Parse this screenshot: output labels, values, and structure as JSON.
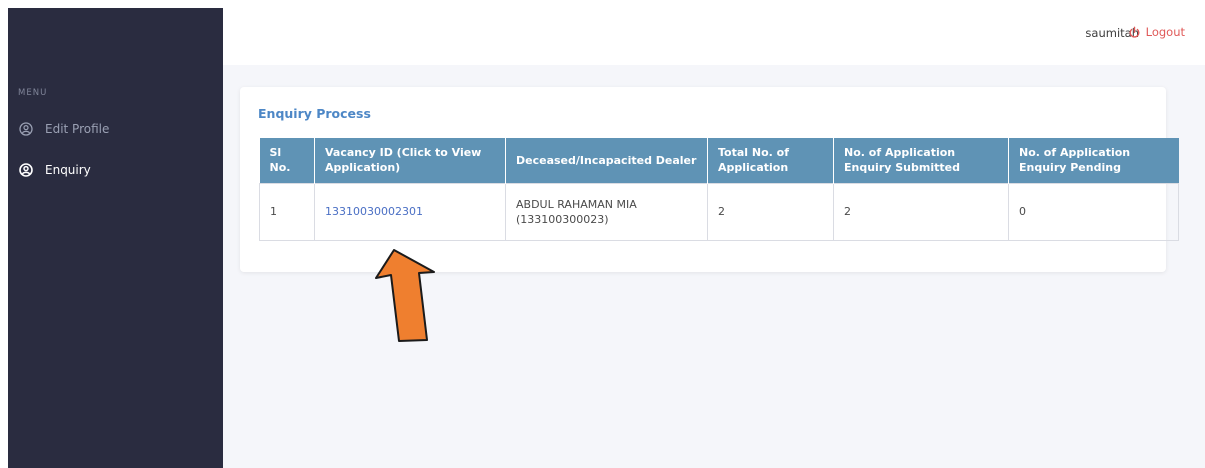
{
  "sidebar": {
    "menu_title": "MENU",
    "items": [
      {
        "label": "Edit Profile",
        "icon": "user-circle-icon"
      },
      {
        "label": "Enquiry",
        "icon": "user-circle-icon",
        "active": true
      }
    ]
  },
  "topbar": {
    "username": "saumitah",
    "logout_label": "Logout",
    "logout_icon": "power-icon"
  },
  "card": {
    "title": "Enquiry Process"
  },
  "table": {
    "headers": [
      "Sl No.",
      "Vacancy ID (Click to View Application)",
      "Deceased/Incapacited Dealer",
      "Total No. of Application",
      "No. of Application Enquiry Submitted",
      "No. of Application Enquiry Pending"
    ],
    "rows": [
      {
        "sl_no": "1",
        "vacancy_id": "13310030002301",
        "dealer": "ABDUL RAHAMAN MIA (133100300023)",
        "total": "2",
        "submitted": "2",
        "pending": "0"
      }
    ]
  },
  "colors": {
    "sidebar_bg": "#2a2c40",
    "header_bg": "#5f93b5",
    "title_blue": "#4d87c6",
    "logout_red": "#e05a59",
    "arrow_orange": "#ef7f2f"
  },
  "annotation": {
    "type": "arrow",
    "direction": "up",
    "icon": "arrow-up-icon"
  }
}
